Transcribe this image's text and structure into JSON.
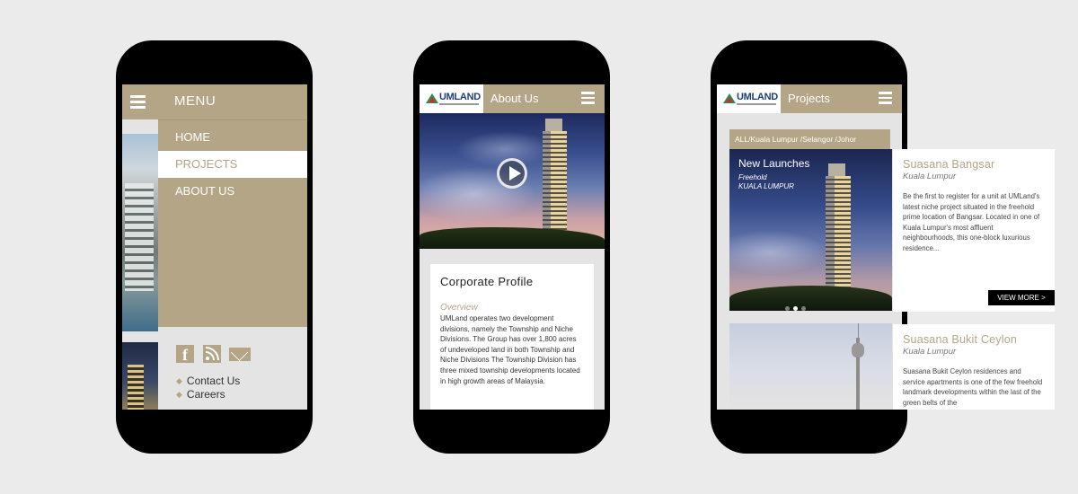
{
  "phone_menu": {
    "menu_title": "MENU",
    "items": [
      {
        "label": "HOME",
        "active": false
      },
      {
        "label": "PROJECTS",
        "active": true
      },
      {
        "label": "ABOUT US",
        "active": false
      }
    ],
    "social_icons": [
      "facebook-icon",
      "rss-icon",
      "mail-icon"
    ],
    "footer_links": [
      "Contact Us",
      "Careers"
    ]
  },
  "phone_about": {
    "logo_text": "UMLAND",
    "header_title": "About Us",
    "card_title": "Corporate Profile",
    "overview_label": "Overview",
    "overview_text": "UMLand operates two development divisions, namely the Township and Niche Divisions. The Group has over 1,800 acres of undeveloped land in both Township and Niche Divisions The Township Division has three mixed township developments located in high growth areas of Malaysia."
  },
  "phone_projects": {
    "logo_text": "UMLAND",
    "header_title": "Projects",
    "filter_text": "ALL/Kuala Lumpur /Selangor /Johor",
    "hero_title": "New Launches",
    "hero_tenure": "Freehold",
    "hero_location": "KUALA LUMPUR",
    "carousel_dots": 3,
    "carousel_active": 2
  },
  "projects": [
    {
      "name": "Suasana Bangsar",
      "location": "Kuala Lumpur",
      "description": "Be the first to register for a unit at UMLand's latest niche project situated in the freehold prime location of Bangsar. Located in one of Kuala Lumpur's most affluent neighbourhoods, this one-block luxurious residence...",
      "cta": "VIEW MORE >"
    },
    {
      "name": "Suasana Bukit Ceylon",
      "location": "Kuala Lumpur",
      "description": "Suasana Bukit Ceylon residences and service apartments is one of the few freehold landmark developments within the last of the green belts of the"
    }
  ],
  "colors": {
    "accent": "#b3a585",
    "background": "#ebebeb",
    "phone_body": "#000000"
  }
}
